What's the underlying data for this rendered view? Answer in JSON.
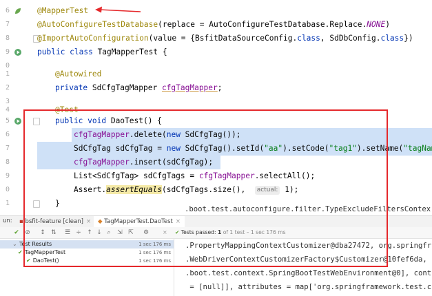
{
  "editor": {
    "line_numbers": [
      "6",
      "7",
      "8",
      "9",
      "0",
      "1",
      "2",
      "3",
      "4",
      "5",
      "6",
      "7",
      "8",
      "9",
      "0",
      "1"
    ],
    "lines": {
      "l1": {
        "annot": "@MapperTest"
      },
      "l2": {
        "annot": "@AutoConfigureTestDatabase",
        "pre": "(replace = AutoConfigureTestDatabase.Replace.",
        "const": "NONE",
        "post": ")"
      },
      "l3": {
        "annot": "@ImportAutoConfiguration",
        "pre": "(value = {BsfitDataSourceConfig.",
        "kw1": "class",
        "mid": ", SdDbConfig.",
        "kw2": "class",
        "post": "})"
      },
      "l4": {
        "kw": "public class",
        "name": " TagMapperTest {"
      },
      "l6": {
        "annot": "@Autowired"
      },
      "l7": {
        "kw": "private",
        "type": " SdCfgTagMapper ",
        "field": "cfgTagMapper",
        "end": ";"
      },
      "l9": {
        "annot": "@Test"
      },
      "l10": {
        "kw": "public void",
        "name": " DaoTest() {"
      },
      "l11": {
        "field": "cfgTagMapper",
        "rest": ".delete(",
        "kw": "new",
        "rest2": " SdCfgTag());"
      },
      "l12": {
        "pre": "SdCfgTag sdCfgTag = ",
        "kw": "new",
        "mid": " SdCfgTag().setId(",
        "s1": "\"aa\"",
        "mid2": ").setCode(",
        "s2": "\"tag1\"",
        "mid3": ").setName(",
        "s3": "\"tagName\""
      },
      "l13": {
        "field": "cfgTagMapper",
        "rest": ".insert(sdCfgTag);"
      },
      "l14": {
        "pre": "List<SdCfgTag> sdCfgTags = ",
        "field": "cfgTagMapper",
        "rest": ".selectAll();"
      },
      "l15": {
        "pre": "Assert.",
        "method": "assertEquals",
        "mid": "(sdCfgTags.size(),  ",
        "hint": "actual:",
        "post": " 1);"
      },
      "l16": {
        "text": "}"
      }
    }
  },
  "console_peek": [
    ".boot.test.autoconfigure.filter.TypeExcludeFiltersContex",
    ".PropertyMappingContextCustomizer@dba27472, org.springfr",
    ".WebDriverContextCustomizerFactory$Customizer@10fef6da,",
    ".boot.test.context.SpringBootTestWebEnvironment@0], cont",
    " = [null]], attributes = map['org.springframework.test.c"
  ],
  "run": {
    "label": "un:",
    "tabs": [
      {
        "label": "bsfit-feature [clean]",
        "close": "×"
      },
      {
        "label": "TagMapperTest.DaoTest",
        "close": "×"
      }
    ],
    "status": {
      "check": "✔",
      "pre": "Tests passed: ",
      "count": "1",
      "post": " of 1 test – 1 sec 176 ms"
    },
    "tree": [
      {
        "label": "Test Results",
        "time": "1 sec 176 ms"
      },
      {
        "label": "TagMapperTest",
        "time": "1 sec 176 ms"
      },
      {
        "label": "DaoTest()",
        "time": "1 sec 176 ms"
      }
    ]
  },
  "colors": {
    "annotation_red": "#e5282b",
    "selection": "#cfe1f7",
    "pass_green": "#5aa02c"
  }
}
